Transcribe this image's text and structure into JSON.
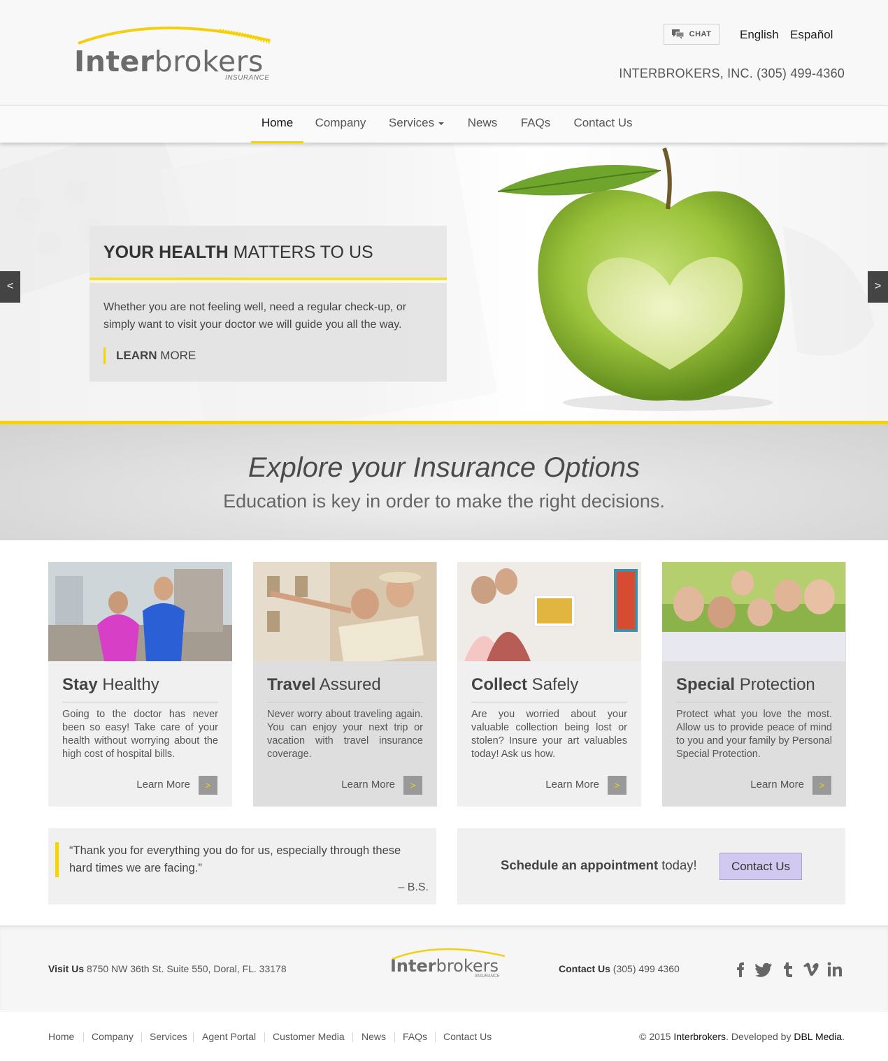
{
  "brand": {
    "name_bold": "Inter",
    "name_light": "brokers",
    "sub": "INSURANCE",
    "accent_color": "#f5d400"
  },
  "header": {
    "chat_label": "CHAT",
    "lang_english": "English",
    "lang_spanish": "Español",
    "phone_line": "INTERBROKERS, INC. (305) 499-4360"
  },
  "nav": {
    "home": "Home",
    "company": "Company",
    "services": "Services",
    "news": "News",
    "faqs": "FAQs",
    "contact": "Contact Us"
  },
  "hero": {
    "title_bold": "YOUR HEALTH",
    "title_rest": " MATTERS TO US",
    "body": "Whether you are not feeling well, need a regular check-up, or simply want to visit your doctor we will guide you all the way.",
    "learn_bold": "LEARN",
    "learn_rest": " MORE",
    "prev": "<",
    "next": ">"
  },
  "explore": {
    "heading": "Explore your Insurance Options",
    "sub": "Education is key in order to make the right decisions."
  },
  "cards": [
    {
      "title_bold": "Stay",
      "title_rest": " Healthy",
      "text": "Going to the doctor has never been so easy! Take care of your health without worrying about the high cost of hospital bills.",
      "learn": "Learn More",
      "arrow": ">"
    },
    {
      "title_bold": "Travel",
      "title_rest": " Assured",
      "text": "Never worry about traveling again. You can enjoy your next trip or vacation with travel insurance coverage.",
      "learn": "Learn More",
      "arrow": ">"
    },
    {
      "title_bold": "Collect",
      "title_rest": " Safely",
      "text": "Are you worried about your valuable collection being lost or stolen? Insure your art valuables today! Ask us how.",
      "learn": "Learn More",
      "arrow": ">"
    },
    {
      "title_bold": "Special",
      "title_rest": " Protection",
      "text": "Protect what you love the most. Allow us to provide peace of mind to you and your family by Personal Special Protection.",
      "learn": "Learn More",
      "arrow": ">"
    }
  ],
  "testimonial": {
    "quote": "“Thank you for everything you do for us, especially through these hard times we are facing.”",
    "author": "– B.S."
  },
  "appointment": {
    "text_bold": "Schedule an appointment",
    "text_rest": " today!",
    "button": "Contact Us"
  },
  "footer": {
    "visit_label": "Visit Us",
    "address": " 8750 NW 36th St. Suite 550, Doral, FL. 33178",
    "contact_label": "Contact Us",
    "phone": " (305) 499 4360",
    "social": [
      "facebook-icon",
      "twitter-icon",
      "tumblr-icon",
      "vimeo-icon",
      "linkedin-icon"
    ]
  },
  "bottom": {
    "links": [
      "Home",
      "Company",
      "Services",
      "Agent Portal",
      "Customer Media",
      "News",
      "FAQs",
      "Contact Us"
    ],
    "copy_prefix": "© 2015 ",
    "copy_brand": "Interbrokers",
    "copy_mid": ". Developed by ",
    "copy_dev": "DBL Media",
    "copy_end": "."
  }
}
